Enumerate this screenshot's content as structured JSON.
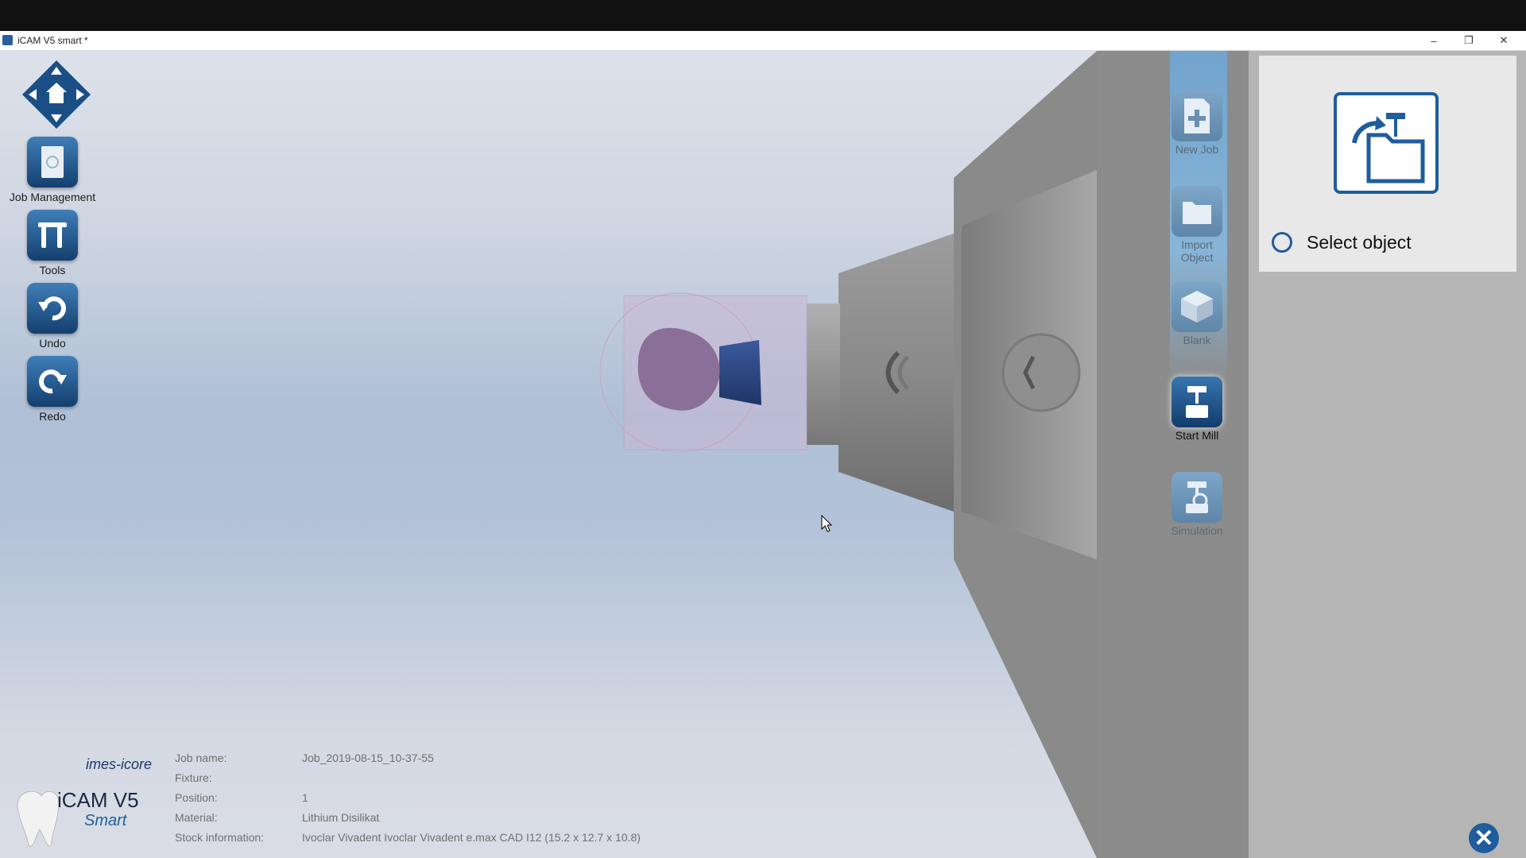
{
  "window": {
    "title": "iCAM V5 smart *"
  },
  "left_toolbar": [
    {
      "label": "Job Management",
      "icon": "document-icon"
    },
    {
      "label": "Tools",
      "icon": "tools-icon"
    },
    {
      "label": "Undo",
      "icon": "undo-icon"
    },
    {
      "label": "Redo",
      "icon": "redo-icon"
    }
  ],
  "right_toolbar": [
    {
      "label": "New Job",
      "icon": "new-file-icon",
      "state": "disabled"
    },
    {
      "label": "Import Object",
      "icon": "folder-icon",
      "state": "disabled"
    },
    {
      "label": "Blank",
      "icon": "blank-box-icon",
      "state": "disabled"
    },
    {
      "label": "Start Mill",
      "icon": "mill-icon",
      "state": "active"
    },
    {
      "label": "Simulation",
      "icon": "simulation-icon",
      "state": "disabled"
    }
  ],
  "select_panel": {
    "label": "Select object"
  },
  "logo": {
    "brand": "imes-icore",
    "product": "iCAM V5",
    "edition": "Smart"
  },
  "job_info": {
    "job_name_label": "Job name:",
    "job_name": "Job_2019-08-15_10-37-55",
    "fixture_label": "Fixture:",
    "fixture": "",
    "position_label": "Position:",
    "position": "1",
    "material_label": "Material:",
    "material": "Lithium Disilikat",
    "stock_label": "Stock information:",
    "stock": "Ivoclar Vivadent Ivoclar Vivadent e.max CAD I12 (15.2 x 12.7 x 10.8)"
  },
  "colors": {
    "accent": "#1f5d9c",
    "panel": "#8c8c8c"
  }
}
